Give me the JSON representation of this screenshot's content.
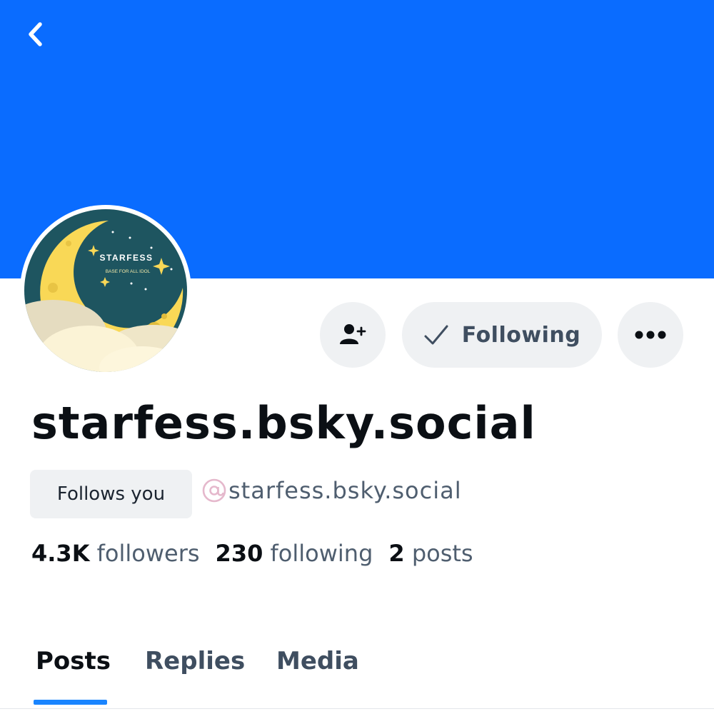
{
  "header": {
    "back_icon": "chevron-left-icon"
  },
  "colors": {
    "banner": "#0a6cff",
    "accent": "#1a85ff",
    "button_bg": "#eff1f3"
  },
  "avatar": {
    "title": "STARFESS",
    "subtitle": "BASE FOR ALL IDOL"
  },
  "actions": {
    "follow_user_icon": "person-plus-icon",
    "following_label": "Following",
    "following_icon": "checkmark-icon",
    "more_icon": "ellipsis-icon"
  },
  "profile": {
    "display_name": "starfess.bsky.social",
    "follows_you": "Follows you",
    "handle": "starfess.bsky.social",
    "handle_icon": "at-sign-icon"
  },
  "stats": {
    "followers_count": "4.3K",
    "followers_label": "followers",
    "following_count": "230",
    "following_label": "following",
    "posts_count": "2",
    "posts_label": "posts"
  },
  "tabs": [
    {
      "label": "Posts",
      "active": true
    },
    {
      "label": "Replies",
      "active": false
    },
    {
      "label": "Media",
      "active": false
    }
  ]
}
